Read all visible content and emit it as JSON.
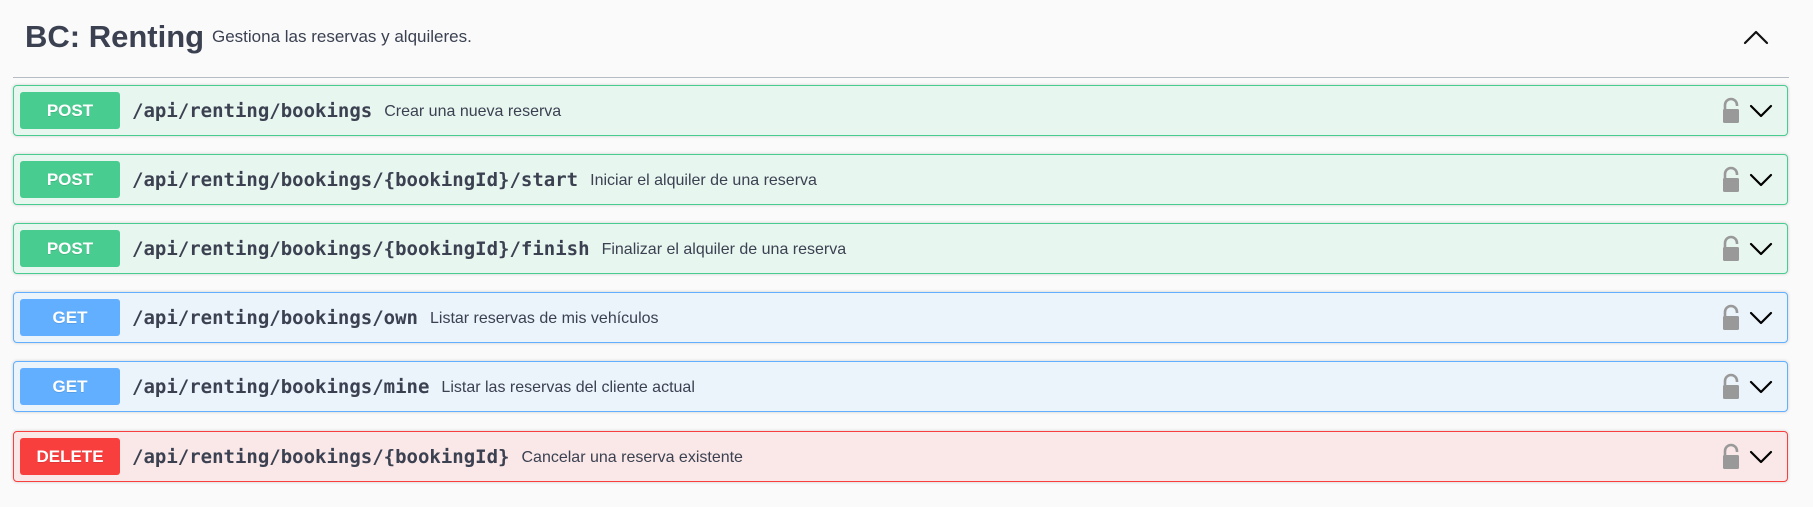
{
  "section": {
    "title": "BC: Renting",
    "description": "Gestiona las reservas y alquileres.",
    "collapse_icon": "chevron-up-icon"
  },
  "operations": [
    {
      "method": "POST",
      "path": "/api/renting/bookings",
      "summary": "Crear una nueva reserva"
    },
    {
      "method": "POST",
      "path": "/api/renting/bookings/{bookingId}/start",
      "summary": "Iniciar el alquiler de una reserva"
    },
    {
      "method": "POST",
      "path": "/api/renting/bookings/{bookingId}/finish",
      "summary": "Finalizar el alquiler de una reserva"
    },
    {
      "method": "GET",
      "path": "/api/renting/bookings/own",
      "summary": "Listar reservas de mis vehículos"
    },
    {
      "method": "GET",
      "path": "/api/renting/bookings/mine",
      "summary": "Listar las reservas del cliente actual"
    },
    {
      "method": "DELETE",
      "path": "/api/renting/bookings/{bookingId}",
      "summary": "Cancelar una reserva existente"
    }
  ],
  "colors": {
    "post": "#49cc90",
    "get": "#61affe",
    "delete": "#f93e3e",
    "text": "#3b4151"
  },
  "icons": {
    "lock": "lock-open-icon",
    "expand": "chevron-down-icon"
  }
}
